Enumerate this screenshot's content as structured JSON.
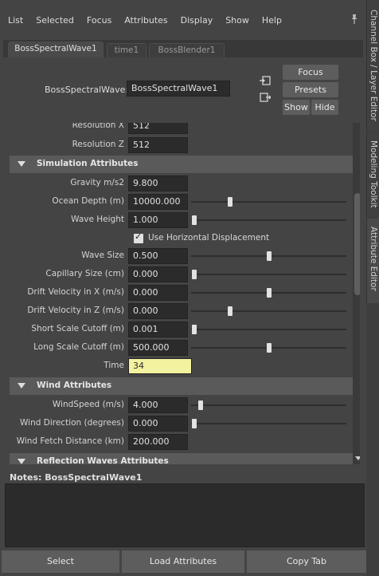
{
  "menu": [
    "List",
    "Selected",
    "Focus",
    "Attributes",
    "Display",
    "Show",
    "Help"
  ],
  "tabs": [
    "BossSpectralWave1",
    "time1",
    "BossBlender1"
  ],
  "node": {
    "label": "BossSpectralWave:",
    "name": "BossSpectralWave1"
  },
  "header_buttons": {
    "focus": "Focus",
    "presets": "Presets",
    "show": "Show",
    "hide": "Hide"
  },
  "attrs": {
    "res_x": {
      "label": "Resolution X",
      "value": "512"
    },
    "res_z": {
      "label": "Resolution Z",
      "value": "512"
    },
    "sim_title": "Simulation Attributes",
    "gravity": {
      "label": "Gravity m/s2",
      "value": "9.800"
    },
    "ocean_depth": {
      "label": "Ocean Depth (m)",
      "value": "10000.000",
      "slider": 0.25
    },
    "wave_height": {
      "label": "Wave Height",
      "value": "1.000",
      "slider": 0.02
    },
    "use_horiz": {
      "label": "Use Horizontal Displacement",
      "checked": true,
      "mark": "✓"
    },
    "wave_size": {
      "label": "Wave Size",
      "value": "0.500",
      "slider": 0.5
    },
    "capillary": {
      "label": "Capillary Size (cm)",
      "value": "0.000",
      "slider": 0.02
    },
    "drift_x": {
      "label": "Drift Velocity in X (m/s)",
      "value": "0.000",
      "slider": 0.5
    },
    "drift_z": {
      "label": "Drift Velocity in Z (m/s)",
      "value": "0.000",
      "slider": 0.25
    },
    "short_cutoff": {
      "label": "Short Scale Cutoff (m)",
      "value": "0.001",
      "slider": 0.02
    },
    "long_cutoff": {
      "label": "Long Scale Cutoff (m)",
      "value": "500.000",
      "slider": 0.5
    },
    "time": {
      "label": "Time",
      "value": "34"
    },
    "wind_title": "Wind Attributes",
    "windspeed": {
      "label": "WindSpeed (m/s)",
      "value": "4.000",
      "slider": 0.06
    },
    "wind_dir": {
      "label": "Wind Direction (degrees)",
      "value": "0.000",
      "slider": 0.02
    },
    "wind_fetch": {
      "label": "Wind Fetch Distance (km)",
      "value": "200.000"
    },
    "refl_title": "Reflection Waves Attributes"
  },
  "notes": {
    "label": "Notes:  BossSpectralWave1"
  },
  "bottom_buttons": {
    "select": "Select",
    "load": "Load Attributes",
    "copy": "Copy Tab"
  },
  "side_tabs": [
    "Channel Box / Layer Editor",
    "Modeling Toolkit",
    "Attribute Editor"
  ]
}
